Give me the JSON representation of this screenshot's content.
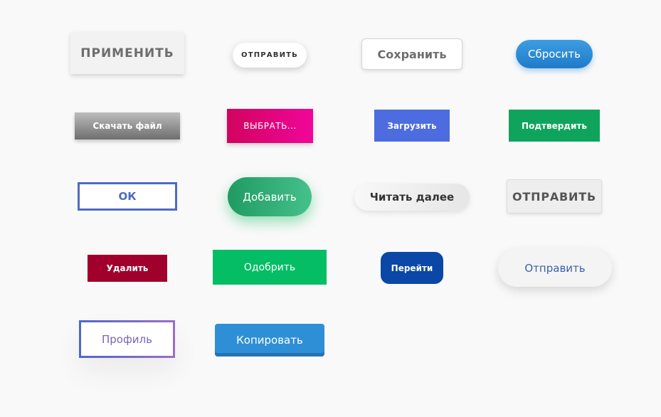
{
  "buttons": {
    "primenit": "ПРИМЕНИТЬ",
    "otpravit_small": "ОТПРАВИТЬ",
    "sohranit": "Сохранить",
    "sbrosit": "Сбросить",
    "skachat": "Скачать файл",
    "vybrat": "ВЫБРАТЬ...",
    "zagruzit": "Загрузить",
    "podtverdit": "Подтвердить",
    "ok": "ОК",
    "dobavit": "Добавить",
    "chitat": "Читать далее",
    "otpravit_caps": "ОТПРАВИТЬ",
    "udalit": "Удалить",
    "odobrit": "Одобрить",
    "pereiti": "Перейти",
    "otpravit_pill": "Отправить",
    "profil": "Профиль",
    "kopirovat": "Копировать"
  },
  "colors": {
    "page_background": "#f9f9f9",
    "blue_pill": "#2f8fd6",
    "pink_gradient": "#e0047a",
    "indigo": "#4c6ce0",
    "green": "#0fa45b",
    "crimson": "#a0002b",
    "emerald": "#04bd65",
    "navy": "#0a47a6"
  }
}
